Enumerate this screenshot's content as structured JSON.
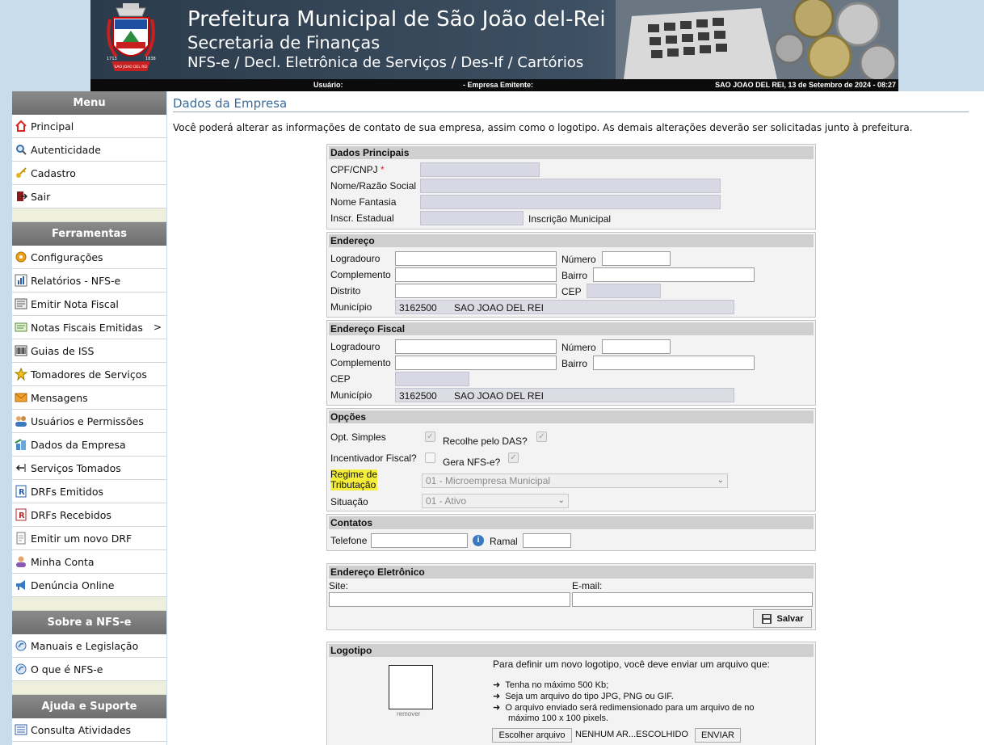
{
  "header": {
    "title": "Prefeitura Municipal de São João del-Rei",
    "subtitle": "Secretaria de Finanças",
    "system": "NFS-e / Decl. Eletrônica de Serviços / Des-If / Cartórios",
    "crest_years_left": "1713",
    "crest_years_right": "1838",
    "crest_city": "SAO JOAO DEL REI",
    "user_label": "Usuário:",
    "company_label": "- Empresa Emitente:",
    "datetime": "SAO JOAO DEL REI, 13 de Setembro de 2024 - 08:27"
  },
  "sidebar": {
    "sections": {
      "menu": "Menu",
      "tools": "Ferramentas",
      "about": "Sobre a NFS-e",
      "help": "Ajuda e Suporte"
    },
    "menu_items": [
      {
        "label": "Principal",
        "icon": "home-icon"
      },
      {
        "label": "Autenticidade",
        "icon": "search-icon"
      },
      {
        "label": "Cadastro",
        "icon": "key-icon"
      },
      {
        "label": "Sair",
        "icon": "exit-icon"
      }
    ],
    "tool_items": [
      {
        "label": "Configurações",
        "icon": "gear-icon"
      },
      {
        "label": "Relatórios - NFS-e",
        "icon": "chart-icon"
      },
      {
        "label": "Emitir Nota Fiscal",
        "icon": "invoice-icon"
      },
      {
        "label": "Notas Fiscais Emitidas",
        "icon": "notes-icon",
        "submenu": ">"
      },
      {
        "label": "Guias de ISS",
        "icon": "barcode-icon"
      },
      {
        "label": "Tomadores de Serviços",
        "icon": "star-icon"
      },
      {
        "label": "Mensagens",
        "icon": "mail-icon"
      },
      {
        "label": "Usuários e Permissões",
        "icon": "users-icon"
      },
      {
        "label": "Dados da Empresa",
        "icon": "company-icon"
      },
      {
        "label": "Serviços Tomados",
        "icon": "arrow-in-icon"
      },
      {
        "label": "DRFs Emitidos",
        "icon": "drf-icon"
      },
      {
        "label": "DRFs Recebidos",
        "icon": "drf-received-icon"
      },
      {
        "label": "Emitir um novo DRF",
        "icon": "document-icon"
      },
      {
        "label": "Minha Conta",
        "icon": "account-icon"
      },
      {
        "label": "Denúncia Online",
        "icon": "megaphone-icon"
      }
    ],
    "about_items": [
      {
        "label": "Manuais e Legislação",
        "icon": "info-icon"
      },
      {
        "label": "O que é NFS-e",
        "icon": "info-icon"
      }
    ],
    "help_items": [
      {
        "label": "Consulta Atividades",
        "icon": "list-icon"
      }
    ]
  },
  "main": {
    "title": "Dados da Empresa",
    "intro": "Você poderá alterar as informações de contato de sua empresa, assim como o logotipo. As demais alterações deverão ser solicitadas junto à prefeitura.",
    "principais": {
      "heading": "Dados Principais",
      "cpf_label": "CPF/CNPJ",
      "required_mark": "*",
      "razao_label": "Nome/Razão Social",
      "fantasia_label": "Nome Fantasia",
      "inscr_estadual_label": "Inscr. Estadual",
      "inscr_municipal_label": "Inscrição Municipal"
    },
    "endereco": {
      "heading": "Endereço",
      "logradouro_label": "Logradouro",
      "numero_label": "Número",
      "complemento_label": "Complemento",
      "bairro_label": "Bairro",
      "distrito_label": "Distrito",
      "cep_label": "CEP",
      "municipio_label": "Município",
      "municipio_code": "3162500",
      "municipio_name": "SAO JOAO DEL REI"
    },
    "endereco_fiscal": {
      "heading": "Endereço Fiscal",
      "logradouro_label": "Logradouro",
      "numero_label": "Número",
      "complemento_label": "Complemento",
      "bairro_label": "Bairro",
      "cep_label": "CEP",
      "municipio_label": "Município",
      "municipio_code": "3162500",
      "municipio_name": "SAO JOAO DEL REI"
    },
    "opcoes": {
      "heading": "Opções",
      "opt_simples_label": "Opt. Simples",
      "recolhe_das_label": "Recolhe pelo DAS?",
      "incentivador_label": "Incentivador Fiscal?",
      "gera_nfse_label": "Gera NFS-e?",
      "regime_label_1": "Regime de",
      "regime_label_2": "Tributação",
      "regime_value": "01 - Microempresa Municipal",
      "situacao_label": "Situação",
      "situacao_value": "01 - Ativo",
      "checkmark": "✓",
      "dropdown_arrow": "⌄"
    },
    "contatos": {
      "heading": "Contatos",
      "telefone_label": "Telefone",
      "info_glyph": "i",
      "ramal_label": "Ramal"
    },
    "endereco_eletronico": {
      "heading": "Endereço Eletrônico",
      "site_label": "Site:",
      "email_label": "E-mail:",
      "save_label": "Salvar"
    },
    "logotipo": {
      "heading": "Logotipo",
      "remove_label": "remover",
      "instructions": "Para definir um novo logotipo, você deve enviar um arquivo que:",
      "rules": [
        "Tenha no máximo 500 Kb;",
        "Seja um arquivo do tipo JPG, PNG ou GIF.",
        "O arquivo enviado será redimensionado para um arquivo de no"
      ],
      "rule_continuation": "máximo 100 x 100 pixels.",
      "bullet": "➜",
      "choose_file_label": "Escolher arquivo",
      "no_file_label": "NENHUM AR...ESCOLHIDO",
      "send_label": "ENVIAR"
    }
  }
}
